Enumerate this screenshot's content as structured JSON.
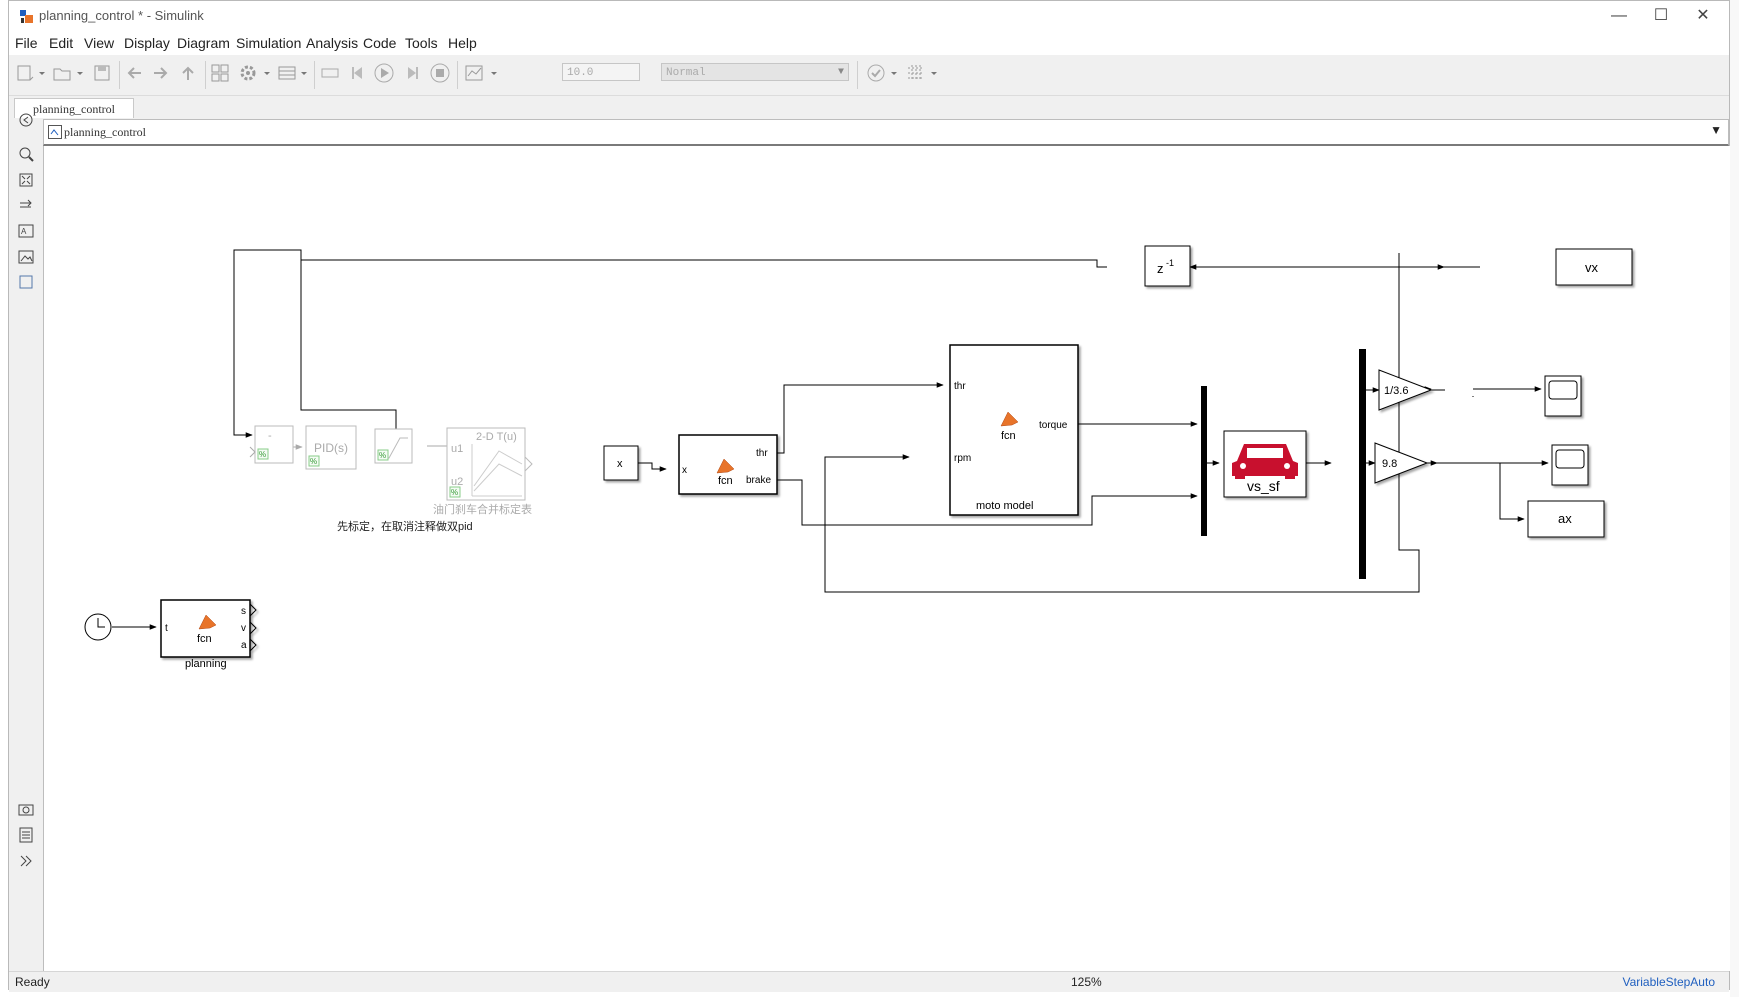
{
  "window": {
    "title": "planning_control * - Simulink"
  },
  "menu": [
    "File",
    "Edit",
    "View",
    "Display",
    "Diagram",
    "Simulation",
    "Analysis",
    "Code",
    "Tools",
    "Help"
  ],
  "toolbar": {
    "stop_time": "10.0",
    "sim_mode": "Normal"
  },
  "tab": {
    "label": "planning_control"
  },
  "address": {
    "path": "planning_control"
  },
  "blocks": {
    "sum_label": "-",
    "pid_label": "PID(s)",
    "lookup_title": "2-D T(u)",
    "lookup_u1": "u1",
    "lookup_u2": "u2",
    "lookup_caption": "油门刹车合并标定表",
    "annotation": "先标定，在取消注释做双pid",
    "x_label": "x",
    "fcn_in": "x",
    "fcn_thr": "thr",
    "fcn_brake": "brake",
    "fcn_name": "fcn",
    "moto_thr": "thr",
    "moto_rpm": "rpm",
    "moto_torque": "torque",
    "moto_fcn": "fcn",
    "moto_caption": "moto model",
    "delay_label": "z",
    "delay_exp": "-1",
    "vehicle_label": "vs_sf",
    "gain1_label": "1/3.6",
    "gain2_label": "9.8",
    "vx_label": "vx",
    "ax_label": "ax",
    "plan_t": "t",
    "plan_s": "s",
    "plan_v": "v",
    "plan_a": "a",
    "plan_fcn": "fcn",
    "plan_caption": "planning"
  },
  "status": {
    "state": "Ready",
    "zoom": "125%",
    "solver": "VariableStepAuto"
  },
  "colors": {
    "vehicle": "#c8102e",
    "solver_link": "#1f5fbf",
    "matlab_icon": "#e8742a"
  }
}
